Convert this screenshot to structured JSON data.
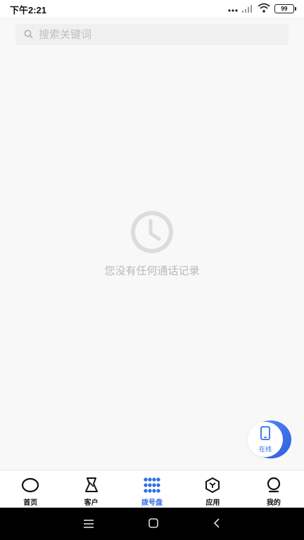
{
  "status_bar": {
    "time": "下午2:21",
    "battery": "99"
  },
  "search": {
    "placeholder": "搜索关键词"
  },
  "empty_state": {
    "message": "您没有任何通话记录",
    "icon": "clock-icon"
  },
  "fab": {
    "label": "在线",
    "icon": "phone-icon"
  },
  "tabs": [
    {
      "label": "首页",
      "icon": "home-circle-icon",
      "active": false
    },
    {
      "label": "客户",
      "icon": "customer-icon",
      "active": false
    },
    {
      "label": "拨号盘",
      "icon": "dialpad-icon",
      "active": true
    },
    {
      "label": "应用",
      "icon": "apps-hexagon-icon",
      "active": false
    },
    {
      "label": "我的",
      "icon": "profile-icon",
      "active": false
    }
  ],
  "colors": {
    "accent": "#2f6fe8",
    "text_muted": "#b8b8b8"
  }
}
